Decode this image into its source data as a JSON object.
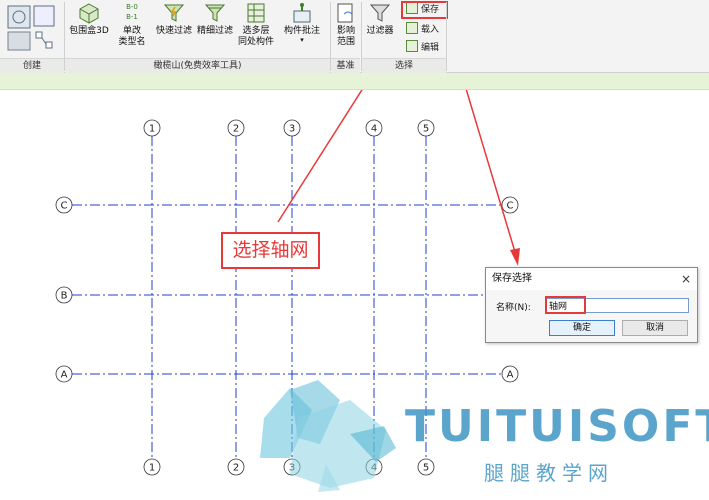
{
  "ribbon": {
    "tools": {
      "bbox3d": "包围盒3D",
      "rename_l1": "单改",
      "rename_l2": "类型名",
      "rename_glyph": "B-0\nB-1",
      "quick_filter": "快速过滤",
      "fine_filter": "精细过滤",
      "multi_l1": "选多层",
      "multi_l2": "同处构件",
      "batch_annot": "构件批注",
      "impact_l1": "影响",
      "impact_l2": "范围",
      "filter": "过滤器",
      "save": "保存",
      "load": "载入",
      "edit": "编辑"
    },
    "panels": {
      "create": "创建",
      "gcs": "橄榄山(免费效率工具)",
      "base": "基准",
      "select": "选择"
    }
  },
  "grid": {
    "columns": [
      "1",
      "2",
      "3",
      "4",
      "5"
    ],
    "rows": [
      "C",
      "B",
      "A"
    ],
    "line_color": "#1f3fd0"
  },
  "annotation": {
    "callout": "选择轴网",
    "color": "#e8393a"
  },
  "dialog": {
    "title": "保存选择",
    "close": "×",
    "name_label": "名称(N):",
    "name_value": "轴网",
    "ok": "确定",
    "cancel": "取消"
  },
  "watermark": {
    "brand": "TUITUISOFT",
    "sub": "腿腿教学网"
  }
}
